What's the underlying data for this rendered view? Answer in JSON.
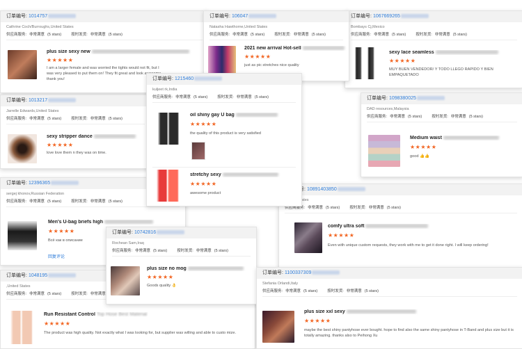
{
  "labels": {
    "order_prefix": "订单编号:",
    "service": "供应商服务:",
    "satisfied": "非常满意",
    "stars_text": "(5 stars)",
    "shipping": "按时发货:",
    "star_glyphs": "★★★★★"
  },
  "cards": [
    {
      "id": "c1",
      "order_id": "1014757",
      "customer": "Cathrine Coch/Burroughs,United States",
      "title": "plus size sexy new",
      "review": "I am a larger female and was worried the tights would not fit, but I was very pleased to put them on! They fit great and look awesome, thank you!"
    },
    {
      "id": "c2",
      "order_id": "106047",
      "customer": "Natasha Hawthorne,United States",
      "title": "2021 new arrival Hot-sell",
      "review": "just as pic stretches nice quality"
    },
    {
      "id": "c3",
      "order_id": "1067669265",
      "customer": "Bombays Cj,Mexico",
      "title": "sexy lace seamless",
      "review": "MUY BUEN VENDEDOR/ Y TODO LLEGO RAPIDO Y BIEN EMPAQUETADO"
    },
    {
      "id": "c4",
      "order_id": "1215460",
      "customer": "kuljeet rk,India",
      "title": "oil shiny gay U bag",
      "review": "the quality of this product is very satisfied",
      "title2": "stretchy sexy",
      "review2": "awesome product"
    },
    {
      "id": "c5",
      "order_id": "1013217",
      "customer": "Jarrelle Edwards,United States",
      "title": "sexy stripper dance",
      "review": "love love them n they was on time."
    },
    {
      "id": "c6",
      "order_id": "1098380025",
      "customer": "DAD resources,Malaysia",
      "title": "Medium waist",
      "review": "good 👍👍"
    },
    {
      "id": "c7",
      "order_id": "12396365",
      "customer": "sergej khonov,Russian Federation",
      "title": "Men's U-bag briefs high",
      "review": "Всё как в описание",
      "link": "回复评论"
    },
    {
      "id": "c8",
      "order_id": "10891403850",
      "customer": ",United States",
      "title": "comfy ultra soft",
      "review": "Even with unique custom requests, they work with me to get it done right. I will keep ordering!"
    },
    {
      "id": "c9",
      "order_id": "10742816",
      "customer": "Rochean Sam,Iraq",
      "title": "plus size no mog",
      "review": "Goods quality 👌"
    },
    {
      "id": "c10",
      "order_id": "1048195",
      "customer": ",United States",
      "title": "Run Resistant Control",
      "title_extra": "Top Hose Best Material",
      "review": "The product was high quality. Not exactly what I was looking for, but supplier was willing and able to custo mize."
    },
    {
      "id": "c11",
      "order_id": "1100337309",
      "customer": "Stefania Orlandi,Italy",
      "title": "plus size xxl sexy",
      "review": "maybe the best shiny pantyhose ever bought. hope to find also the same shiny pantyhose in T-Band and plus size but it is totally amazing. thanks also to Peihong Xu"
    }
  ]
}
